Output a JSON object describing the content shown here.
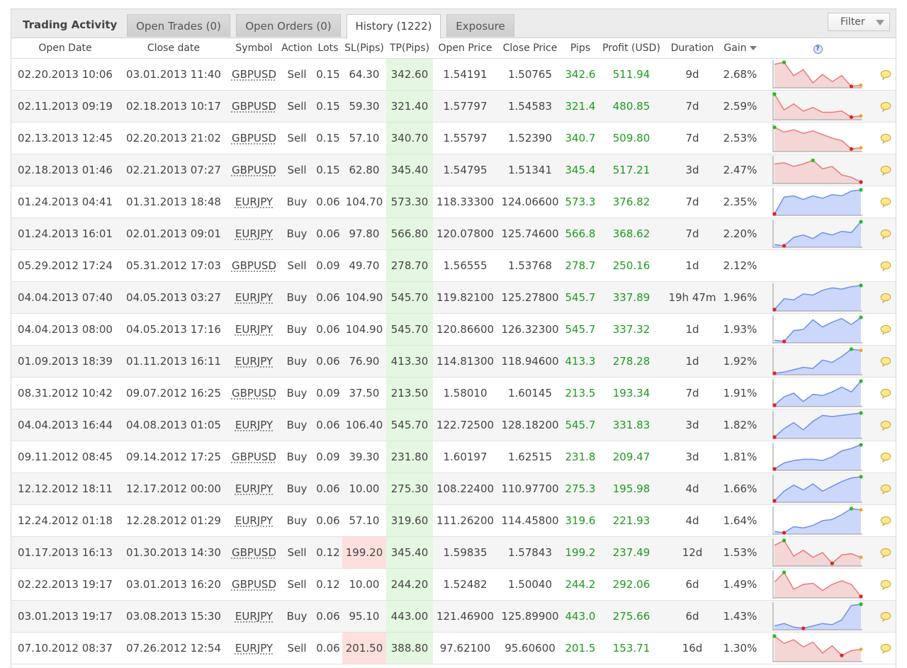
{
  "header": {
    "title": "Trading Activity",
    "tabs": [
      {
        "label": "Open Trades (0)"
      },
      {
        "label": "Open Orders (0)"
      },
      {
        "label": "History (1222)"
      },
      {
        "label": "Exposure"
      }
    ],
    "filter_label": "Filter"
  },
  "columns": [
    "Open Date",
    "Close date",
    "Symbol",
    "Action",
    "Lots",
    "SL(Pips)",
    "TP(Pips)",
    "Open Price",
    "Close Price",
    "Pips",
    "Profit (USD)",
    "Duration",
    "Gain"
  ],
  "help_icon_text": "?",
  "colors": {
    "profit_green": "#1e9b1e",
    "tp_cell_bg": "#e4f7e0",
    "sl_hit_bg": "#fde0de",
    "spark_sell_fill": "#f4d6d6",
    "spark_sell_line": "#e97b7b",
    "spark_buy_fill": "#ccd8fb",
    "spark_buy_line": "#6f8ff0"
  },
  "rows": [
    {
      "open": "02.20.2013 10:06",
      "close": "03.01.2013 11:40",
      "symbol": "GBPUSD",
      "action": "Sell",
      "lots": "0.15",
      "sl": "64.30",
      "tp": "342.60",
      "open_price": "1.54191",
      "close_price": "1.50765",
      "pips": "342.6",
      "profit": "511.94",
      "duration": "9d",
      "gain": "2.68%",
      "sl_hit": false,
      "spark": [
        0.92,
        1.0,
        0.45,
        0.7,
        0.15,
        0.5,
        0.2,
        0.45,
        0.0,
        0.05
      ]
    },
    {
      "open": "02.11.2013 09:19",
      "close": "02.18.2013 10:17",
      "symbol": "GBPUSD",
      "action": "Sell",
      "lots": "0.15",
      "sl": "59.30",
      "tp": "321.40",
      "open_price": "1.57797",
      "close_price": "1.54583",
      "pips": "321.4",
      "profit": "480.85",
      "duration": "7d",
      "gain": "2.59%",
      "sl_hit": false,
      "spark": [
        1.0,
        0.35,
        0.6,
        0.3,
        0.45,
        0.25,
        0.25,
        0.3,
        0.05,
        0.1
      ]
    },
    {
      "open": "02.13.2013 12:45",
      "close": "02.20.2013 21:02",
      "symbol": "GBPUSD",
      "action": "Sell",
      "lots": "0.15",
      "sl": "57.10",
      "tp": "340.70",
      "open_price": "1.55797",
      "close_price": "1.52390",
      "pips": "340.7",
      "profit": "509.80",
      "duration": "7d",
      "gain": "2.53%",
      "sl_hit": false,
      "spark": [
        0.95,
        0.75,
        0.85,
        0.7,
        0.8,
        0.65,
        0.5,
        0.4,
        0.05,
        0.1
      ]
    },
    {
      "open": "02.18.2013 01:46",
      "close": "02.21.2013 07:27",
      "symbol": "GBPUSD",
      "action": "Sell",
      "lots": "0.15",
      "sl": "62.80",
      "tp": "345.40",
      "open_price": "1.54795",
      "close_price": "1.51341",
      "pips": "345.4",
      "profit": "517.21",
      "duration": "3d",
      "gain": "2.47%",
      "sl_hit": false,
      "spark": [
        0.75,
        0.8,
        0.65,
        0.75,
        0.9,
        0.55,
        0.65,
        0.3,
        0.2,
        0.0
      ]
    },
    {
      "open": "01.24.2013 04:41",
      "close": "01.31.2013 18:48",
      "symbol": "EURJPY",
      "action": "Buy",
      "lots": "0.06",
      "sl": "104.70",
      "tp": "573.30",
      "open_price": "118.33300",
      "close_price": "124.06600",
      "pips": "573.3",
      "profit": "376.82",
      "duration": "7d",
      "gain": "2.35%",
      "sl_hit": false,
      "spark": [
        0.0,
        0.7,
        0.75,
        0.6,
        0.75,
        0.65,
        0.8,
        0.75,
        0.95,
        1.0
      ]
    },
    {
      "open": "01.24.2013 16:01",
      "close": "02.01.2013 09:01",
      "symbol": "EURJPY",
      "action": "Buy",
      "lots": "0.06",
      "sl": "97.80",
      "tp": "566.80",
      "open_price": "120.07800",
      "close_price": "125.74600",
      "pips": "566.8",
      "profit": "368.62",
      "duration": "7d",
      "gain": "2.20%",
      "sl_hit": false,
      "spark": [
        0.05,
        0.0,
        0.35,
        0.45,
        0.3,
        0.55,
        0.45,
        0.6,
        0.55,
        1.0
      ]
    },
    {
      "open": "05.29.2012 17:24",
      "close": "05.31.2012 17:03",
      "symbol": "GBPUSD",
      "action": "Sell",
      "lots": "0.09",
      "sl": "49.70",
      "tp": "278.70",
      "open_price": "1.56555",
      "close_price": "1.53768",
      "pips": "278.7",
      "profit": "250.16",
      "duration": "1d",
      "gain": "2.12%",
      "sl_hit": false,
      "spark": []
    },
    {
      "open": "04.04.2013 07:40",
      "close": "04.05.2013 03:27",
      "symbol": "EURJPY",
      "action": "Buy",
      "lots": "0.06",
      "sl": "104.90",
      "tp": "545.70",
      "open_price": "119.82100",
      "close_price": "125.27800",
      "pips": "545.7",
      "profit": "337.89",
      "duration": "19h 47m",
      "gain": "1.96%",
      "sl_hit": false,
      "spark": [
        0.0,
        0.45,
        0.4,
        0.65,
        0.6,
        0.8,
        0.9,
        0.85,
        0.95,
        1.0
      ]
    },
    {
      "open": "04.04.2013 08:00",
      "close": "04.05.2013 17:16",
      "symbol": "EURJPY",
      "action": "Buy",
      "lots": "0.06",
      "sl": "104.90",
      "tp": "545.70",
      "open_price": "120.86600",
      "close_price": "126.32300",
      "pips": "545.7",
      "profit": "337.32",
      "duration": "1d",
      "gain": "1.93%",
      "sl_hit": false,
      "spark": [
        0.05,
        0.0,
        0.45,
        0.5,
        0.9,
        0.6,
        0.8,
        0.95,
        0.7,
        1.0
      ]
    },
    {
      "open": "01.09.2013 18:39",
      "close": "01.11.2013 16:11",
      "symbol": "EURJPY",
      "action": "Buy",
      "lots": "0.06",
      "sl": "76.90",
      "tp": "413.30",
      "open_price": "114.81300",
      "close_price": "118.94600",
      "pips": "413.3",
      "profit": "278.28",
      "duration": "1d",
      "gain": "1.92%",
      "sl_hit": false,
      "spark": [
        0.0,
        0.05,
        0.15,
        0.25,
        0.2,
        0.55,
        0.45,
        0.7,
        1.0,
        0.95
      ]
    },
    {
      "open": "08.31.2012 10:42",
      "close": "09.07.2012 16:25",
      "symbol": "GBPUSD",
      "action": "Buy",
      "lots": "0.09",
      "sl": "37.50",
      "tp": "213.50",
      "open_price": "1.58010",
      "close_price": "1.60145",
      "pips": "213.5",
      "profit": "193.34",
      "duration": "7d",
      "gain": "1.91%",
      "sl_hit": false,
      "spark": [
        0.0,
        0.35,
        0.5,
        0.15,
        0.45,
        0.4,
        0.55,
        0.75,
        0.55,
        1.0
      ]
    },
    {
      "open": "04.04.2013 16:44",
      "close": "04.08.2013 01:05",
      "symbol": "EURJPY",
      "action": "Buy",
      "lots": "0.06",
      "sl": "106.40",
      "tp": "545.70",
      "open_price": "122.72500",
      "close_price": "128.18200",
      "pips": "545.7",
      "profit": "331.83",
      "duration": "3d",
      "gain": "1.82%",
      "sl_hit": false,
      "spark": [
        0.0,
        0.35,
        0.6,
        0.3,
        0.65,
        0.9,
        0.85,
        0.9,
        0.95,
        1.0
      ]
    },
    {
      "open": "09.11.2012 08:45",
      "close": "09.14.2012 17:25",
      "symbol": "GBPUSD",
      "action": "Buy",
      "lots": "0.09",
      "sl": "39.30",
      "tp": "231.80",
      "open_price": "1.60197",
      "close_price": "1.62515",
      "pips": "231.8",
      "profit": "209.47",
      "duration": "3d",
      "gain": "1.81%",
      "sl_hit": false,
      "spark": [
        0.0,
        0.25,
        0.35,
        0.4,
        0.4,
        0.35,
        0.5,
        0.75,
        0.85,
        1.0
      ]
    },
    {
      "open": "12.12.2012 18:11",
      "close": "12.17.2012 00:00",
      "symbol": "EURJPY",
      "action": "Buy",
      "lots": "0.06",
      "sl": "10.00",
      "tp": "275.30",
      "open_price": "108.22400",
      "close_price": "110.97700",
      "pips": "275.3",
      "profit": "195.98",
      "duration": "4d",
      "gain": "1.66%",
      "sl_hit": false,
      "spark": [
        0.0,
        0.4,
        0.65,
        0.45,
        0.7,
        0.4,
        0.6,
        0.8,
        0.95,
        1.0
      ]
    },
    {
      "open": "12.24.2012 01:18",
      "close": "12.28.2012 01:29",
      "symbol": "EURJPY",
      "action": "Buy",
      "lots": "0.06",
      "sl": "57.10",
      "tp": "319.60",
      "open_price": "111.26200",
      "close_price": "114.45800",
      "pips": "319.6",
      "profit": "221.93",
      "duration": "4d",
      "gain": "1.64%",
      "sl_hit": false,
      "spark": [
        0.05,
        0.0,
        0.25,
        0.2,
        0.3,
        0.5,
        0.55,
        0.75,
        1.0,
        0.95
      ]
    },
    {
      "open": "01.17.2013 16:13",
      "close": "01.30.2013 14:30",
      "symbol": "GBPUSD",
      "action": "Sell",
      "lots": "0.12",
      "sl": "199.20",
      "tp": "345.40",
      "open_price": "1.59835",
      "close_price": "1.57843",
      "pips": "199.2",
      "profit": "237.49",
      "duration": "12d",
      "gain": "1.53%",
      "sl_hit": true,
      "spark": [
        0.8,
        1.0,
        0.35,
        0.6,
        0.3,
        0.5,
        0.05,
        0.4,
        0.45,
        0.3
      ]
    },
    {
      "open": "02.22.2013 19:17",
      "close": "03.01.2013 16:20",
      "symbol": "GBPUSD",
      "action": "Sell",
      "lots": "0.12",
      "sl": "10.00",
      "tp": "244.20",
      "open_price": "1.52482",
      "close_price": "1.50040",
      "pips": "244.2",
      "profit": "292.06",
      "duration": "6d",
      "gain": "1.49%",
      "sl_hit": false,
      "spark": [
        0.6,
        1.0,
        0.3,
        0.5,
        0.55,
        0.25,
        0.5,
        0.65,
        0.5,
        0.0
      ]
    },
    {
      "open": "03.01.2013 19:17",
      "close": "03.08.2013 15:30",
      "symbol": "EURJPY",
      "action": "Buy",
      "lots": "0.06",
      "sl": "95.10",
      "tp": "443.00",
      "open_price": "121.46900",
      "close_price": "125.89900",
      "pips": "443.0",
      "profit": "275.66",
      "duration": "6d",
      "gain": "1.43%",
      "sl_hit": false,
      "spark": [
        0.1,
        0.2,
        0.05,
        0.0,
        0.1,
        0.2,
        0.15,
        0.35,
        0.95,
        1.0
      ]
    },
    {
      "open": "07.10.2012 08:37",
      "close": "07.26.2012 12:54",
      "symbol": "EURJPY",
      "action": "Sell",
      "lots": "0.06",
      "sl": "201.50",
      "tp": "388.80",
      "open_price": "97.62100",
      "close_price": "95.60600",
      "pips": "201.5",
      "profit": "153.71",
      "duration": "16d",
      "gain": "1.30%",
      "sl_hit": true,
      "spark": [
        1.0,
        0.7,
        0.85,
        0.55,
        0.75,
        0.3,
        0.6,
        0.2,
        0.4,
        0.45
      ]
    }
  ]
}
